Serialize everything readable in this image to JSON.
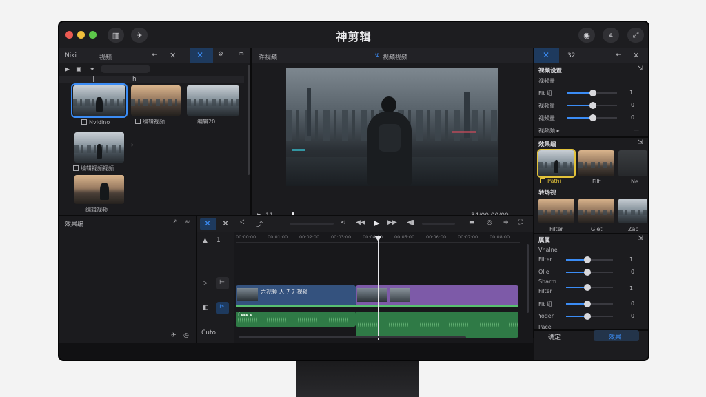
{
  "app": {
    "title": "神剪辑"
  },
  "media": {
    "tabs": [
      "Niki",
      "视频"
    ],
    "items": [
      {
        "label": "Nvidino",
        "style": "cool"
      },
      {
        "label": "编辑视频",
        "style": "warm"
      },
      {
        "label": "编辑20",
        "style": "cool"
      },
      {
        "label": "编辑视频视频",
        "style": "cool"
      },
      {
        "label": "编辑视频",
        "style": "warm"
      }
    ],
    "col_marks": [
      "|",
      "h"
    ],
    "next_arrow": "›"
  },
  "viewer": {
    "left_title": "许视频",
    "right_title": "视频视频",
    "time_left": "11",
    "time_right": "34/00  00/00"
  },
  "inspector": {
    "tab_num": "32",
    "section1_title": "视频设置",
    "rows1": [
      {
        "label": "视频量",
        "value": ""
      },
      {
        "label": "Fit 组",
        "value": "1"
      },
      {
        "label": "视频量",
        "value": "0"
      },
      {
        "label": "视频量",
        "value": "0"
      },
      {
        "label": "视频频 ▸",
        "value": "—"
      }
    ],
    "filters_title": "效果编",
    "filters": [
      {
        "label": "Pathi",
        "style": "cool"
      },
      {
        "label": "Filt",
        "style": "warm"
      },
      {
        "label": "Ne",
        "style": "dark"
      }
    ],
    "filters2_title": "转场视",
    "filters2": [
      {
        "label": "Filter",
        "style": "warm"
      },
      {
        "label": "Giet",
        "style": "warm"
      },
      {
        "label": "Zap",
        "style": "cool"
      }
    ],
    "adjust_title": "属属",
    "adjust_rows": [
      {
        "label": "Vnalne",
        "value": ""
      },
      {
        "label": "Filter",
        "value": "1"
      },
      {
        "label": "Olle",
        "value": "0"
      },
      {
        "label": "Sharm",
        "value": ""
      },
      {
        "label": "Filter",
        "value": "1"
      },
      {
        "label": "Fit 组",
        "value": "0"
      },
      {
        "label": "Yoder",
        "value": "0"
      },
      {
        "label": "Pace",
        "value": ""
      }
    ],
    "btn_left": "确定",
    "btn_right": "效果"
  },
  "timeline": {
    "panel_title": "效果编",
    "ruler": [
      "00:00:00",
      "00:01:00",
      "00:02:00",
      "00:03:00",
      "00:04:00",
      "00:05:00",
      "00:06:00",
      "00:07:00",
      "00:08:00"
    ],
    "track_num": "1",
    "clip_video1_label": "六视频 人 7 7 视频",
    "audio_label": "f ▸▸▸ ▸",
    "footer_label": "Cuto"
  },
  "colors": {
    "accent": "#3b8cf5",
    "video_clip": "#3a5a8c",
    "purple_clip": "#7d5aa8",
    "audio_clip": "#2f7a46"
  }
}
